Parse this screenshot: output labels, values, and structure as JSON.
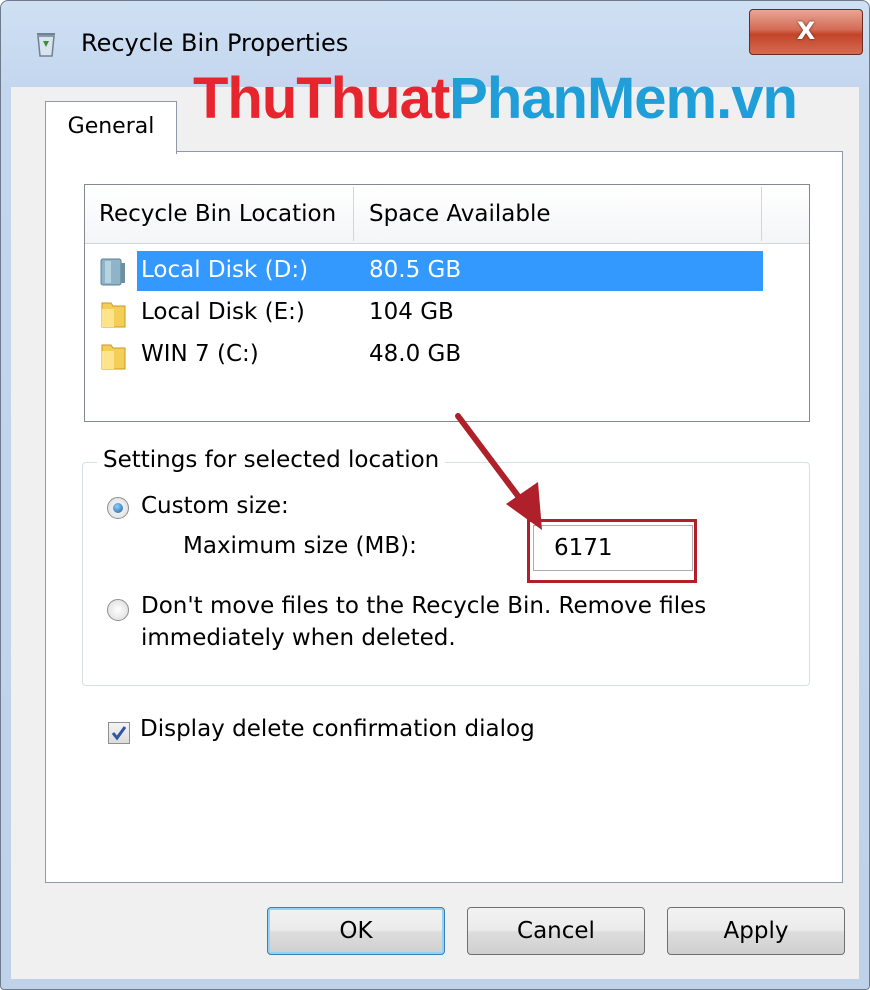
{
  "window": {
    "title": "Recycle Bin Properties",
    "close_label": "X"
  },
  "watermark": {
    "part1": "ThuThuat",
    "part2": "PhanMem.vn"
  },
  "tabs": [
    {
      "label": "General",
      "active": true
    }
  ],
  "location_list": {
    "columns": [
      "Recycle Bin Location",
      "Space Available"
    ],
    "rows": [
      {
        "name": "Local Disk (D:)",
        "space": "80.5 GB",
        "selected": true,
        "icon": "drive-icon"
      },
      {
        "name": "Local Disk (E:)",
        "space": "104 GB",
        "selected": false,
        "icon": "folder-icon"
      },
      {
        "name": "WIN 7 (C:)",
        "space": "48.0 GB",
        "selected": false,
        "icon": "folder-icon"
      }
    ]
  },
  "settings": {
    "legend": "Settings for selected location",
    "custom_size_label": "Custom size:",
    "custom_size_selected": true,
    "max_size_label": "Maximum size (MB):",
    "max_size_value": "6171",
    "dont_move_line1": "Don't move files to the Recycle Bin. Remove files",
    "dont_move_line2": "immediately when deleted.",
    "dont_move_selected": false
  },
  "confirmation": {
    "label": "Display delete confirmation dialog",
    "checked": true
  },
  "buttons": {
    "ok": "OK",
    "cancel": "Cancel",
    "apply": "Apply"
  },
  "colors": {
    "selection": "#3399ff",
    "annotation": "#b0202a",
    "watermark_red": "#e7252e",
    "watermark_blue": "#1f9ed8"
  }
}
